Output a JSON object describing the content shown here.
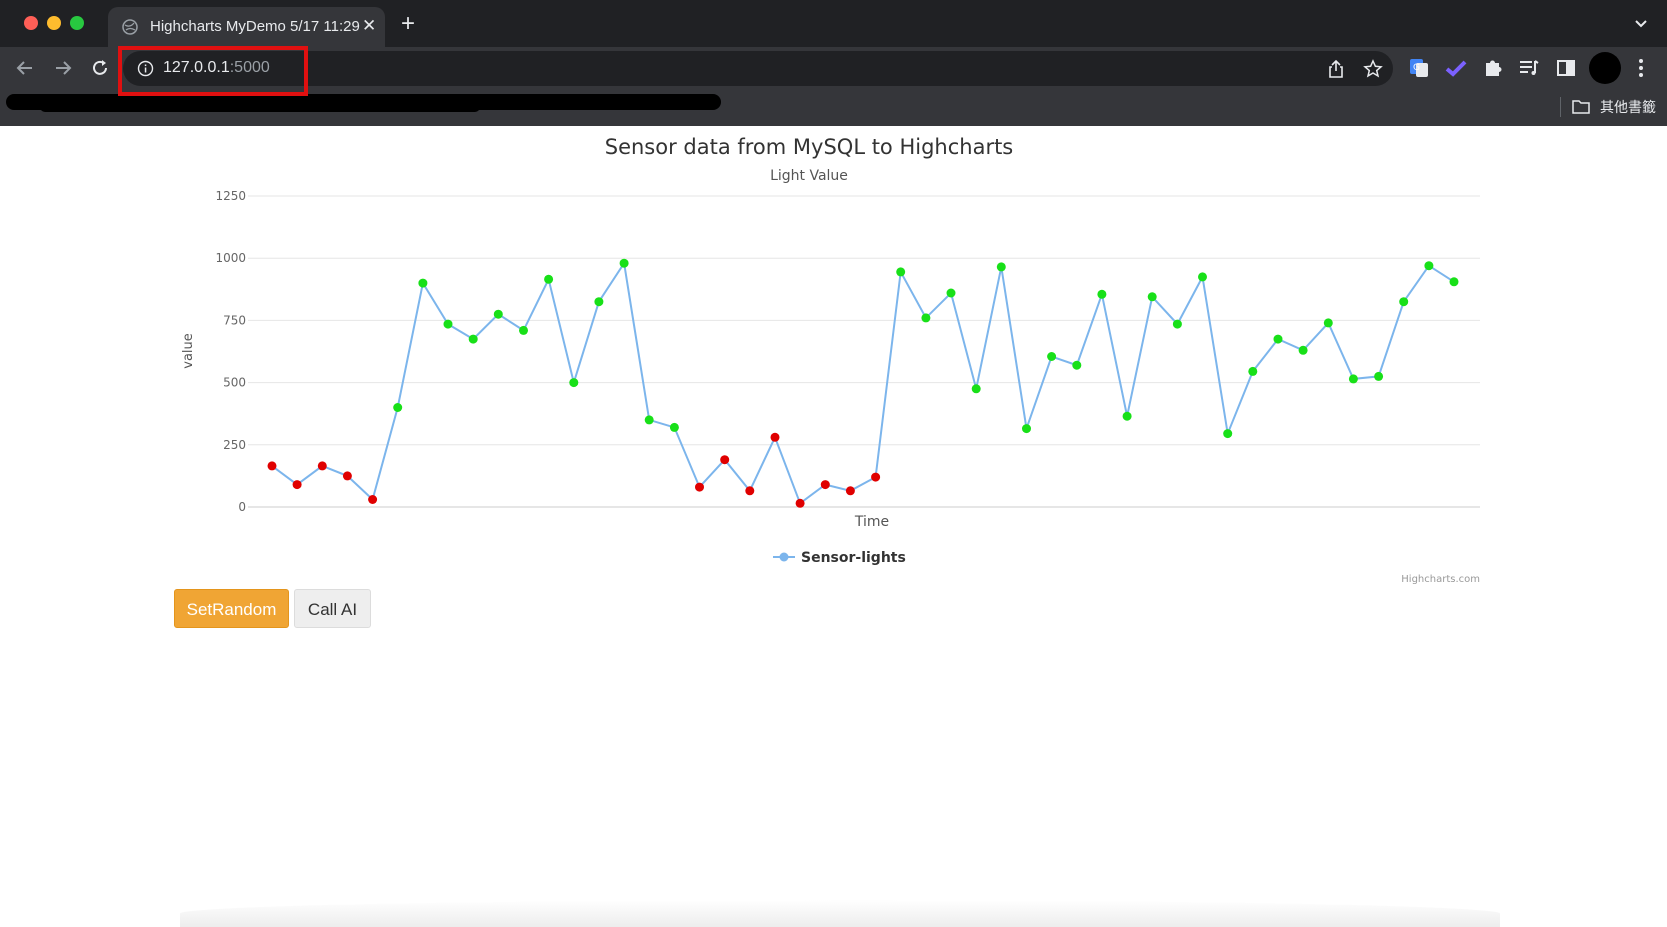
{
  "browser": {
    "tab": {
      "title": "Highcharts MyDemo 5/17 11:29",
      "close_glyph": "✕"
    },
    "new_tab_glyph": "+",
    "url_host": "127.0.0.1",
    "url_port": ":5000",
    "bookmarks": {
      "other_bookmarks_label": "其他書籤"
    },
    "icons": [
      "back-arrow-icon",
      "forward-arrow-icon",
      "reload-icon",
      "info-icon",
      "share-icon",
      "star-icon",
      "translate-icon",
      "checkmark-extension-icon",
      "puzzle-extensions-icon",
      "reading-list-icon",
      "side-panel-icon",
      "profile-avatar",
      "kebab-menu-icon",
      "chevron-down-icon",
      "folder-icon"
    ]
  },
  "page": {
    "set_random_label": "SetRandom",
    "call_ai_label": "Call AI"
  },
  "chart_data": {
    "type": "line",
    "title": "Sensor data from MySQL to Highcharts",
    "subtitle": "Light Value",
    "xlabel": "Time",
    "ylabel": "value",
    "ylim": [
      0,
      1250
    ],
    "yticks": [
      "0",
      "250",
      "500",
      "750",
      "1000",
      "1250"
    ],
    "legend_position": "bottom-center",
    "credits": "Highcharts.com",
    "grid": true,
    "line_color": "#7cb5ec",
    "point_colors": {
      "low": "#e00000",
      "high": "#18e018"
    },
    "series": [
      {
        "name": "Sensor-lights",
        "values": [
          165,
          90,
          165,
          125,
          30,
          400,
          900,
          735,
          675,
          775,
          710,
          915,
          500,
          825,
          980,
          350,
          320,
          80,
          190,
          65,
          280,
          15,
          90,
          65,
          120,
          945,
          760,
          860,
          475,
          965,
          315,
          605,
          570,
          855,
          365,
          845,
          735,
          925,
          295,
          545,
          675,
          630,
          740,
          515,
          525,
          825,
          970,
          905
        ],
        "point_level": [
          "low",
          "low",
          "low",
          "low",
          "low",
          "high",
          "high",
          "high",
          "high",
          "high",
          "high",
          "high",
          "high",
          "high",
          "high",
          "high",
          "high",
          "low",
          "low",
          "low",
          "low",
          "low",
          "low",
          "low",
          "low",
          "high",
          "high",
          "high",
          "high",
          "high",
          "high",
          "high",
          "high",
          "high",
          "high",
          "high",
          "high",
          "high",
          "high",
          "high",
          "high",
          "high",
          "high",
          "high",
          "high",
          "high",
          "high",
          "high"
        ]
      }
    ]
  }
}
